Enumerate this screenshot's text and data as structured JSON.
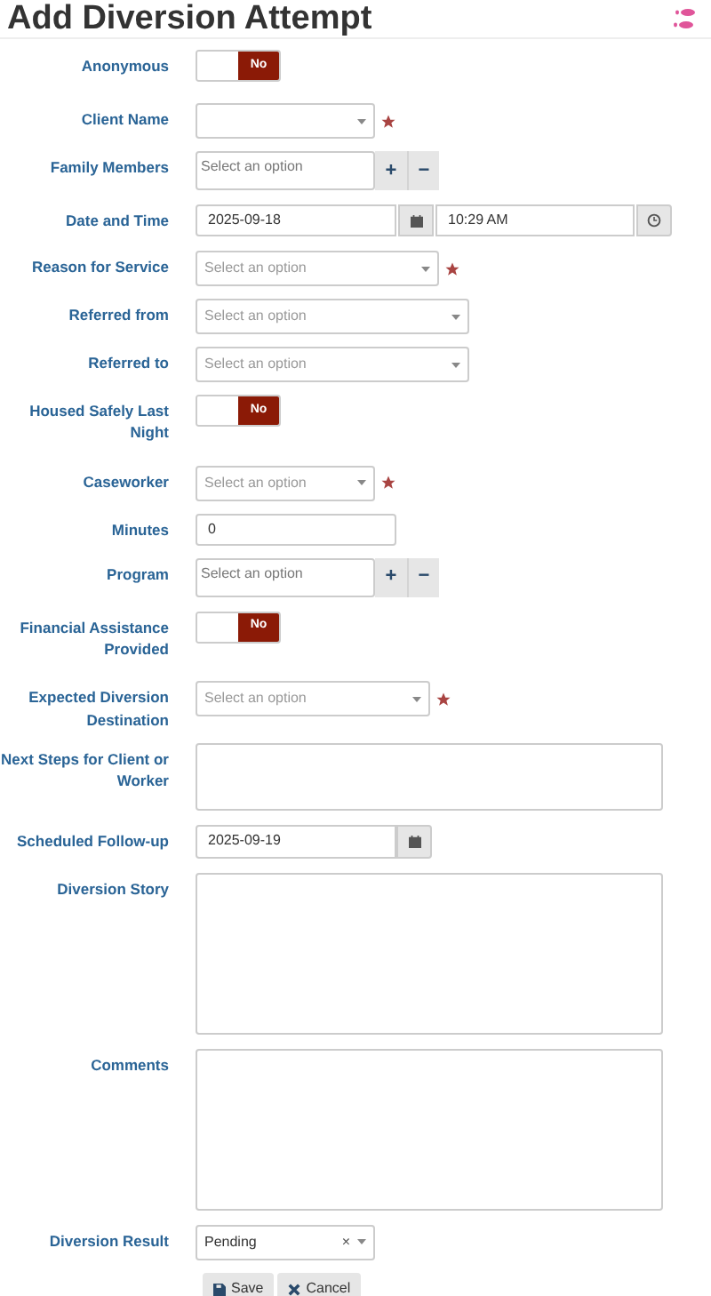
{
  "title": "Add Diversion Attempt",
  "fields": [
    {
      "kind": "toggle",
      "label": "Anonymous",
      "on": false,
      "toggle_text": "No"
    },
    {
      "kind": "select",
      "label": "Client Name",
      "required": true
    },
    {
      "kind": "multi",
      "label": "Family Members",
      "placeholder": "Select an option",
      "add": "+",
      "remove": "−"
    },
    {
      "kind": "datetime",
      "label": "Date and Time",
      "date": "2025-09-18",
      "time": "10:29 AM"
    },
    {
      "kind": "select",
      "label": "Reason for Service",
      "placeholder": "Select an option",
      "required": true
    },
    {
      "kind": "select",
      "label": "Referred from",
      "placeholder": "Select an option",
      "required": false
    },
    {
      "kind": "select",
      "label": "Referred to",
      "placeholder": "Select an option",
      "required": false
    },
    {
      "kind": "toggle",
      "label": "Housed Safely Last Night",
      "on": false,
      "toggle_text": "No"
    },
    {
      "kind": "select",
      "label": "Caseworker",
      "placeholder": "Select an option",
      "required": true
    },
    {
      "kind": "number",
      "label": "Minutes",
      "value": "0"
    },
    {
      "kind": "multi",
      "label": "Program",
      "placeholder": "Select an option",
      "add": "+",
      "remove": "−"
    },
    {
      "kind": "toggle",
      "label": "Financial Assistance Provided",
      "on": false,
      "toggle_text": "No"
    },
    {
      "kind": "select",
      "label": "Expected Diversion Destination",
      "placeholder": "Select an option",
      "required": true
    },
    {
      "kind": "textarea",
      "label": "Next Steps for Client or Worker"
    },
    {
      "kind": "date",
      "label": "Scheduled Follow-up",
      "date": "2025-09-19"
    },
    {
      "kind": "textarea",
      "label": "Diversion Story"
    },
    {
      "kind": "textarea",
      "label": "Comments"
    },
    {
      "kind": "select",
      "label": "Diversion Result",
      "value": "Pending",
      "clear": "×",
      "required": false
    }
  ],
  "buttons": [
    {
      "kind": "save",
      "label": "Save"
    },
    {
      "kind": "cancel",
      "label": "Cancel"
    }
  ]
}
